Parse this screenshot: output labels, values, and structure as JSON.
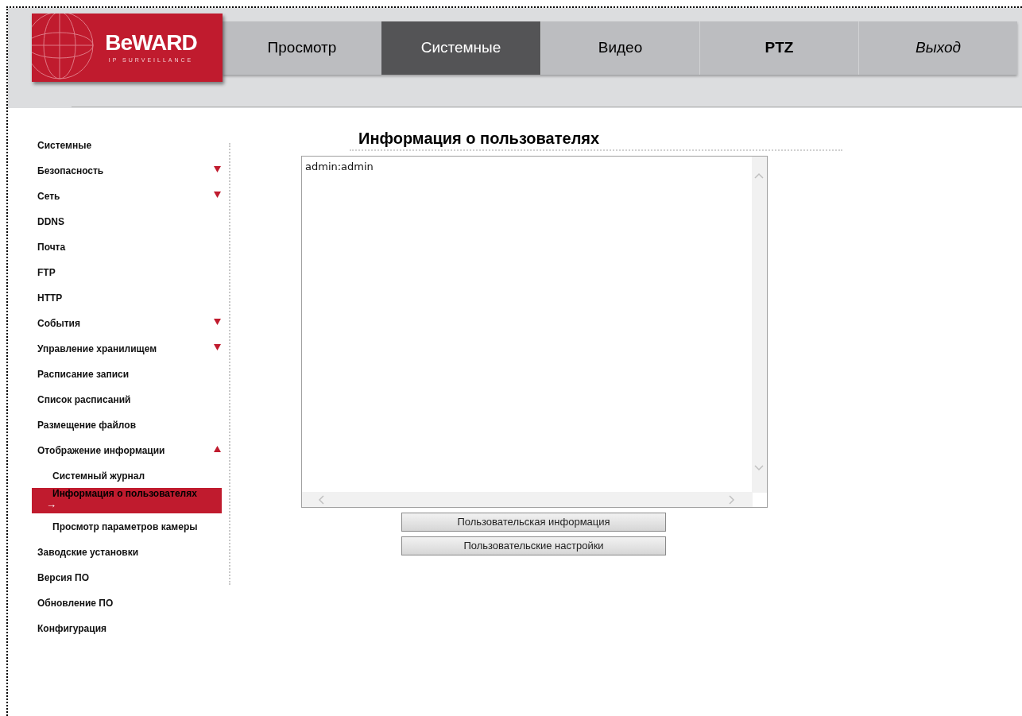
{
  "logo": {
    "name": "BeWARD",
    "tagline": "IP SURVEILLANCE"
  },
  "tabs": [
    {
      "label": "Просмотр",
      "selected": false,
      "kind": "normal"
    },
    {
      "label": "Системные",
      "selected": true,
      "kind": "normal"
    },
    {
      "label": "Видео",
      "selected": false,
      "kind": "normal"
    },
    {
      "label": "PTZ",
      "selected": false,
      "kind": "bold"
    },
    {
      "label": "Выход",
      "selected": false,
      "kind": "exit"
    }
  ],
  "sidebar": {
    "items": [
      {
        "label": "Системные",
        "selected": false
      },
      {
        "label": "Безопасность",
        "selected": false,
        "expanded": false
      },
      {
        "label": "Сеть",
        "selected": false,
        "expanded": false
      },
      {
        "label": "DDNS",
        "selected": false
      },
      {
        "label": "Почта",
        "selected": false
      },
      {
        "label": "FTP",
        "selected": false
      },
      {
        "label": "HTTP",
        "selected": false
      },
      {
        "label": "События",
        "selected": false,
        "expanded": false
      },
      {
        "label": "Управление хранилищем",
        "selected": false,
        "expanded": false
      },
      {
        "label": "Расписание записи",
        "selected": false
      },
      {
        "label": "Список расписаний",
        "selected": false
      },
      {
        "label": "Размещение файлов",
        "selected": false
      },
      {
        "label": "Отображение информации",
        "selected": false,
        "expanded": true,
        "children": [
          {
            "label": "Системный журнал",
            "selected": false
          },
          {
            "label": "Информация о пользователях",
            "selected": true,
            "marker": "→"
          },
          {
            "label": "Просмотр параметров камеры",
            "selected": false
          }
        ]
      },
      {
        "label": "Заводские установки",
        "selected": false
      },
      {
        "label": "Версия ПО",
        "selected": false
      },
      {
        "label": "Обновление ПО",
        "selected": false
      },
      {
        "label": "Конфигурация",
        "selected": false
      }
    ]
  },
  "content": {
    "title": "Информация о пользователях",
    "text_area": {
      "value": "admin:admin"
    },
    "buttons": [
      "Пользовательская информация",
      "Пользовательские настройки"
    ]
  }
}
